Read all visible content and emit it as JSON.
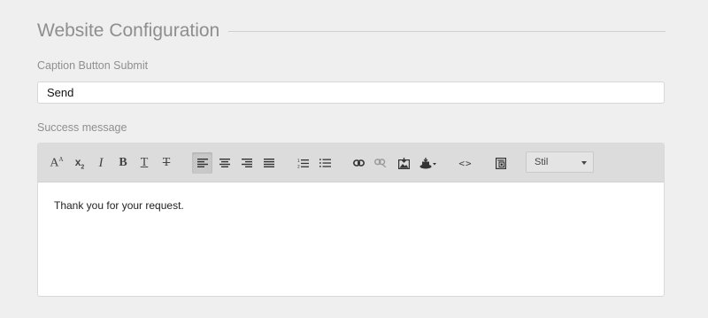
{
  "section": {
    "title": "Website Configuration"
  },
  "caption_field": {
    "label": "Caption Button Submit",
    "value": "Send"
  },
  "success_field": {
    "label": "Success message"
  },
  "toolbar": {
    "font_size": "A",
    "font_size_small": "A",
    "subscript": "x",
    "subscript_small": "2",
    "italic": "I",
    "bold": "B",
    "underline": "T",
    "strikethrough": "T",
    "code_view": "<>",
    "style_select": "Stil"
  },
  "editor": {
    "content": "Thank you for your request."
  }
}
